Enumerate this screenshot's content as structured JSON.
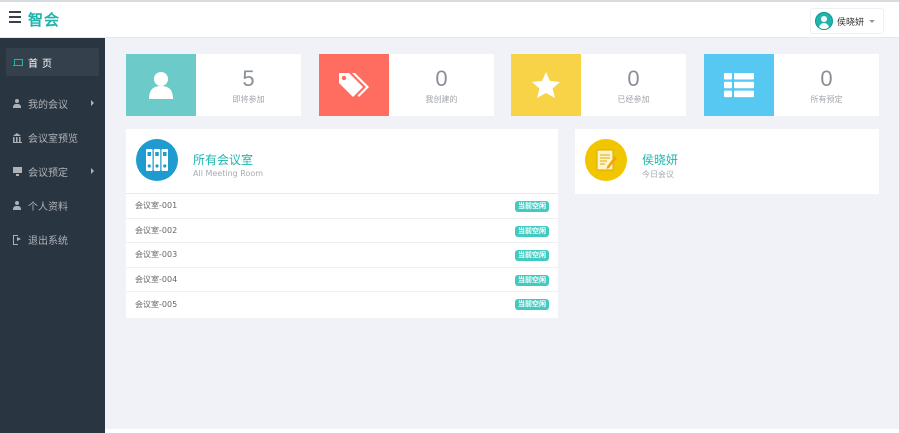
{
  "header": {
    "brand": "智会",
    "user_name": "侯晓妍"
  },
  "sidebar": {
    "items": [
      {
        "label": "首页",
        "icon": "laptop-icon"
      },
      {
        "label": "我的会议",
        "icon": "user-icon"
      },
      {
        "label": "会议室预览",
        "icon": "bank-icon"
      },
      {
        "label": "会议预定",
        "icon": "monitor-icon"
      },
      {
        "label": "个人资料",
        "icon": "user-icon"
      },
      {
        "label": "退出系统",
        "icon": "sign-out-icon"
      }
    ]
  },
  "stats": [
    {
      "value": "5",
      "label": "即将参加",
      "color": "#6ccac9",
      "icon": "user-icon"
    },
    {
      "value": "0",
      "label": "我创建的",
      "color": "#ff6c60",
      "icon": "tags-icon"
    },
    {
      "value": "0",
      "label": "已经参加",
      "color": "#f8d347",
      "icon": "star-icon"
    },
    {
      "value": "0",
      "label": "所有预定",
      "color": "#57c8f2",
      "icon": "list-icon"
    }
  ],
  "rooms_panel": {
    "title": "所有会议室",
    "subtitle": "All Meeting Room",
    "icon_color": "#1f9bcf",
    "rooms": [
      {
        "name": "会议室-001",
        "status": "当前空闲"
      },
      {
        "name": "会议室-002",
        "status": "当前空闲"
      },
      {
        "name": "会议室-003",
        "status": "当前空闲"
      },
      {
        "name": "会议室-004",
        "status": "当前空闲"
      },
      {
        "name": "会议室-005",
        "status": "当前空闲"
      }
    ]
  },
  "user_panel": {
    "name": "侯晓妍",
    "subtitle": "今日会议",
    "icon_color": "#f1c500"
  },
  "colors": {
    "accent": "#1fb5ac",
    "sidebar_bg": "#2a3542",
    "badge": "#41cac0"
  }
}
